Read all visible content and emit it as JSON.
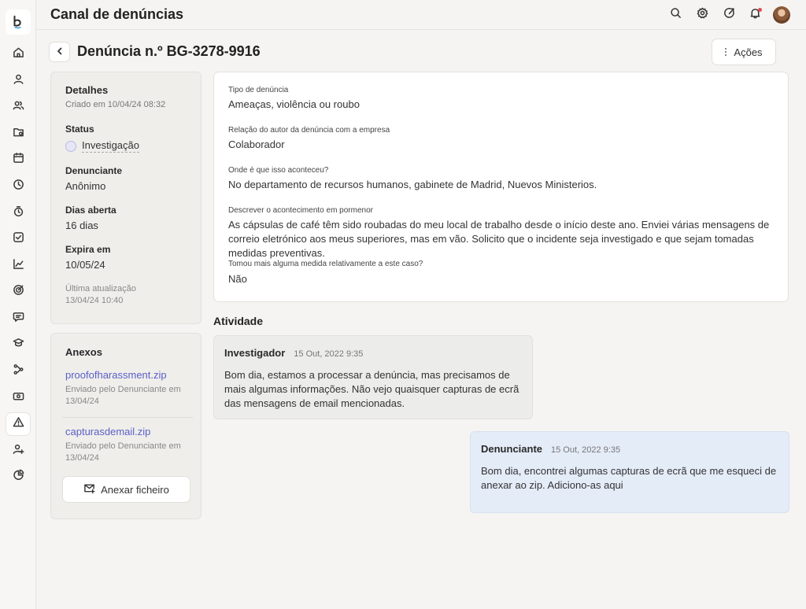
{
  "app": {
    "title": "Canal de denúncias"
  },
  "sidebar": {
    "icons": [
      "home-icon",
      "user-icon",
      "users-icon",
      "folder-icon",
      "calendar-icon",
      "clock-icon",
      "timer-icon",
      "check-icon",
      "chart-icon",
      "target-icon",
      "chat-icon",
      "education-icon",
      "workflow-icon",
      "money-icon",
      "alert-icon",
      "user-add-icon",
      "pie-chart-icon"
    ],
    "active": "alert-icon"
  },
  "header": {
    "back_label": "‹",
    "title": "Denúncia n.º BG-3278-9916",
    "actions_label": "Ações"
  },
  "details": {
    "heading": "Detalhes",
    "created": "Criado em 10/04/24 08:32",
    "status_label": "Status",
    "status_value": "Investigação",
    "reporter_label": "Denunciante",
    "reporter_value": "Anônimo",
    "days_label": "Dias aberta",
    "days_value": "16 dias",
    "expires_label": "Expira em",
    "expires_value": "10/05/24",
    "updated_label": "Última atualização",
    "updated_value": "13/04/24 10:40"
  },
  "attachments": {
    "heading": "Anexos",
    "files": [
      {
        "name": "proofofharassment.zip",
        "meta": "Enviado pelo Denunciante em 13/04/24"
      },
      {
        "name": "capturasdemail.zip",
        "meta": "Enviado pelo Denunciante em 13/04/24"
      }
    ],
    "attach_button": "Anexar ficheiro"
  },
  "report": {
    "fields": [
      {
        "question": "Tipo de denúncia",
        "answer": "Ameaças, violência ou roubo"
      },
      {
        "question": "Relação do autor da denúncia com a empresa",
        "answer": "Colaborador"
      },
      {
        "question": "Onde é que isso aconteceu?",
        "answer": "No departamento de recursos humanos, gabinete de Madrid, Nuevos Ministerios."
      },
      {
        "question": "Descrever o acontecimento em pormenor",
        "answer": "As cápsulas de café têm sido roubadas do meu local de trabalho desde o início deste ano. Enviei várias mensagens de correio eletrónico aos meus superiores, mas em vão. Solicito que o incidente seja investigado e que sejam tomadas medidas preventivas."
      },
      {
        "question": "Tomou mais alguma medida relativamente a este caso?",
        "answer": "Não"
      }
    ]
  },
  "activity": {
    "title": "Atividade",
    "messages": [
      {
        "author": "Investigador",
        "time": "15 Out, 2022 9:35",
        "text": "Bom dia, estamos a processar a denúncia, mas precisamos de mais algumas informações. Não vejo quaisquer capturas de ecrã das mensagens de email mencionadas."
      },
      {
        "author": "Denunciante",
        "time": "15 Out, 2022 9:35",
        "text": "Bom dia, encontrei algumas capturas de ecrã que me esqueci de anexar ao zip. Adiciono-as aqui"
      }
    ]
  },
  "colors": {
    "link": "#5b5fc7",
    "notification": "#e5484d",
    "reporter_bubble": "#e4ecf8",
    "status_dot": "#b9bbe6"
  }
}
